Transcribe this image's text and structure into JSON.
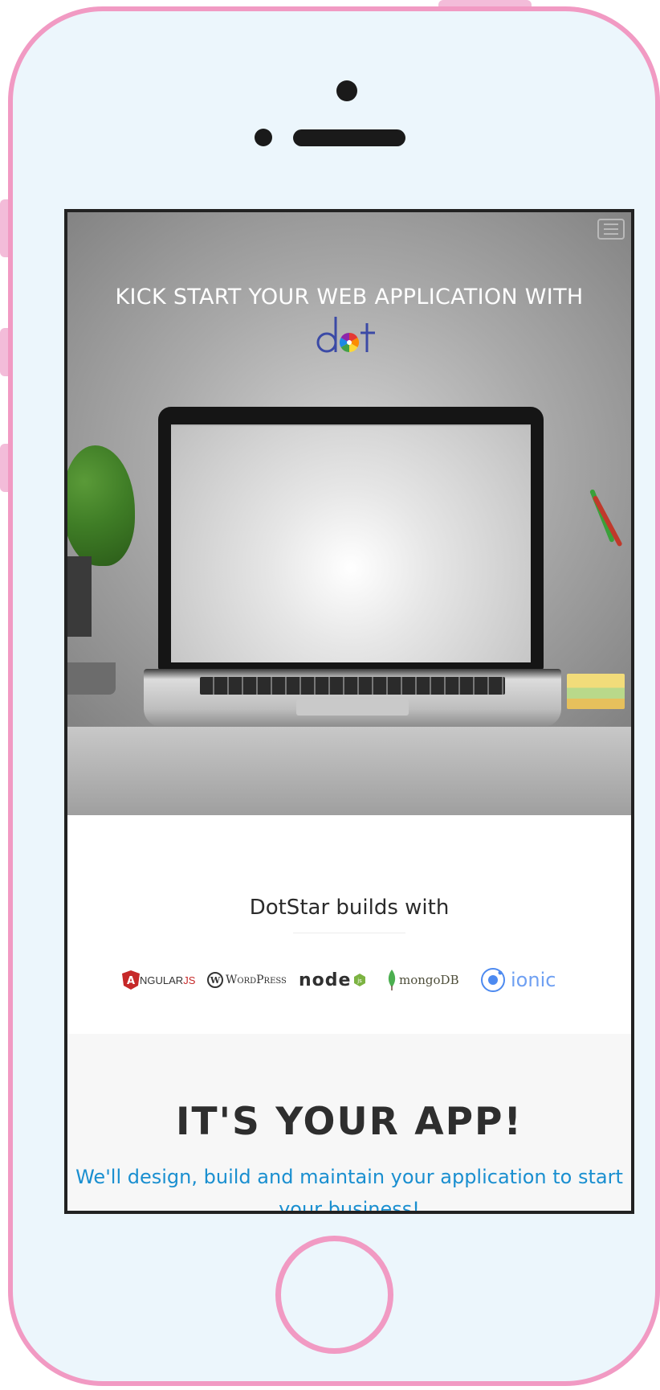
{
  "hero": {
    "title": "KICK START YOUR WEB APPLICATION WITH",
    "logo_text": "dot",
    "menu_icon": "hamburger-menu-icon"
  },
  "builds": {
    "title": "DotStar builds with",
    "logos": [
      {
        "name": "angularjs-logo",
        "text_main": "NGULAR",
        "text_accent": "JS",
        "letter": "A"
      },
      {
        "name": "wordpress-logo",
        "text": "WordPress",
        "letter": "W"
      },
      {
        "name": "nodejs-logo",
        "text": "node",
        "suffix": "js"
      },
      {
        "name": "mongodb-logo",
        "text": "mongoDB"
      },
      {
        "name": "ionic-logo",
        "text": "ionic"
      }
    ]
  },
  "app_section": {
    "title": "IT'S YOUR APP!",
    "subtitle": "We'll design, build and maintain your application to start your business!"
  },
  "colors": {
    "phone_frame": "#f19ac3",
    "phone_body": "#ecf6fc",
    "accent_blue": "#1a8fd0",
    "heading_dark": "#2e2e2e"
  }
}
